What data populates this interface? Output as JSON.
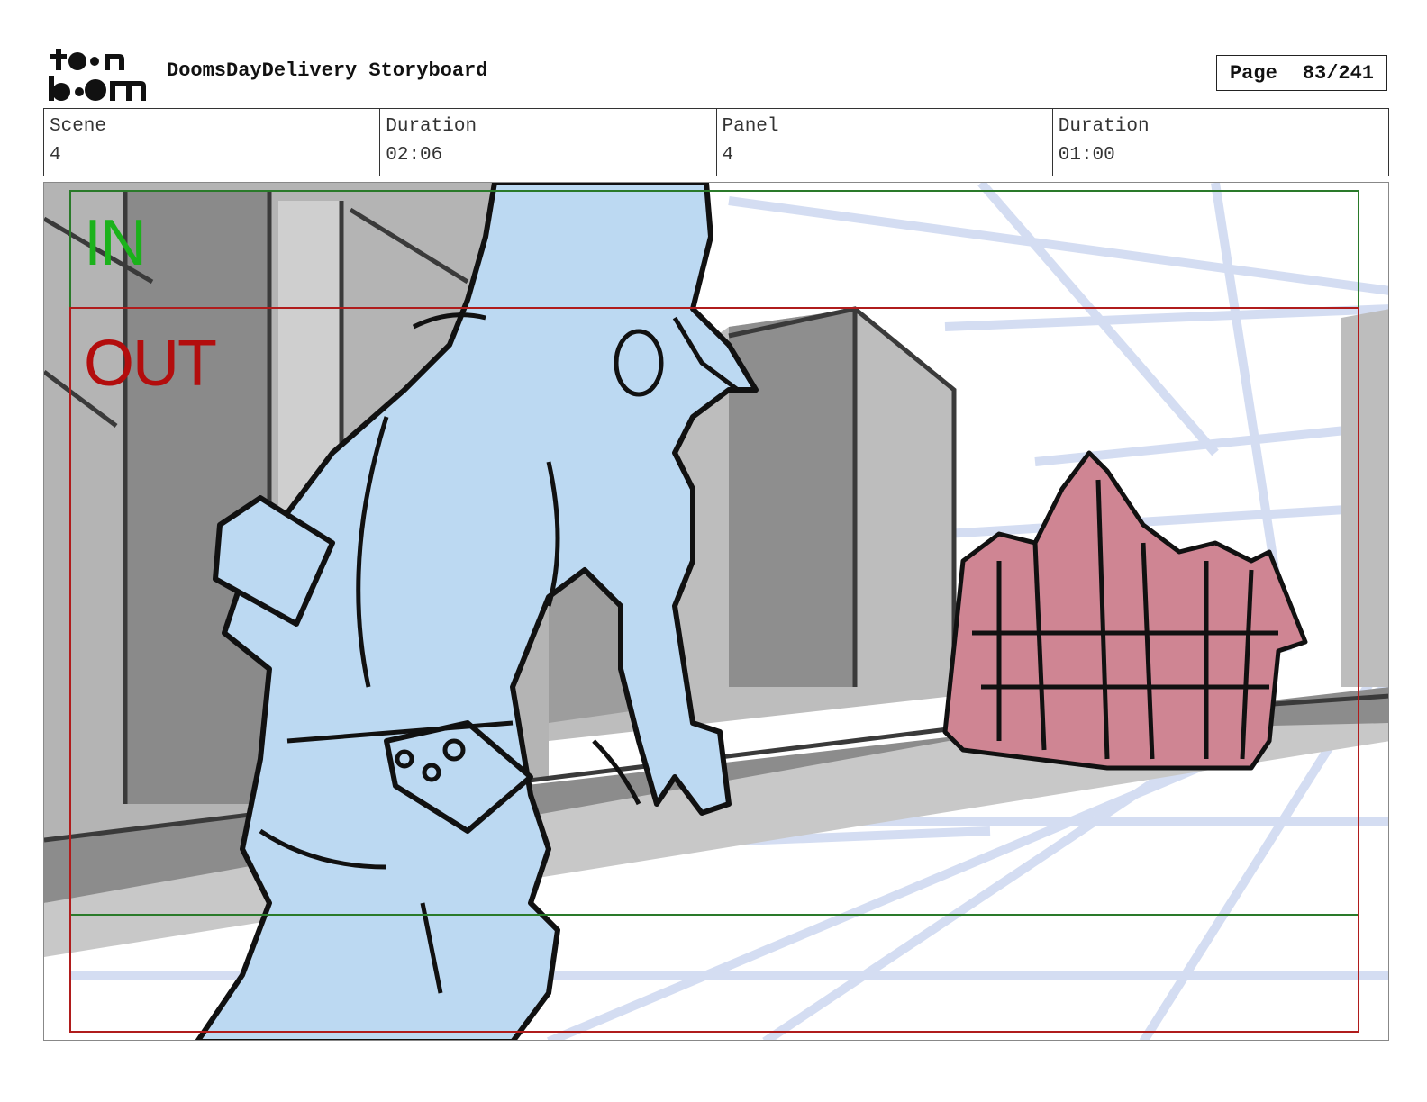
{
  "header": {
    "logo_text_top": "toon",
    "logo_text_bottom": "boom",
    "title": "DoomsDayDelivery Storyboard",
    "page_label": "Page",
    "page_value": "83/241"
  },
  "info": {
    "scene_label": "Scene",
    "scene_value": "4",
    "duration1_label": "Duration",
    "duration1_value": "02:06",
    "panel_label": "Panel",
    "panel_value": "4",
    "duration2_label": "Duration",
    "duration2_value": "01:00"
  },
  "panel": {
    "in_label": "IN",
    "out_label": "OUT"
  },
  "colors": {
    "in_frame": "#2a7a2a",
    "in_text": "#1bb21b",
    "out_frame": "#b01c1c",
    "out_text": "#b30d0d",
    "character_fill": "#bcd9f2",
    "crowd_fill": "#cf8593",
    "building_gray": "#a9a9a9"
  },
  "icons": {
    "logo": "toon-boom-logo"
  }
}
